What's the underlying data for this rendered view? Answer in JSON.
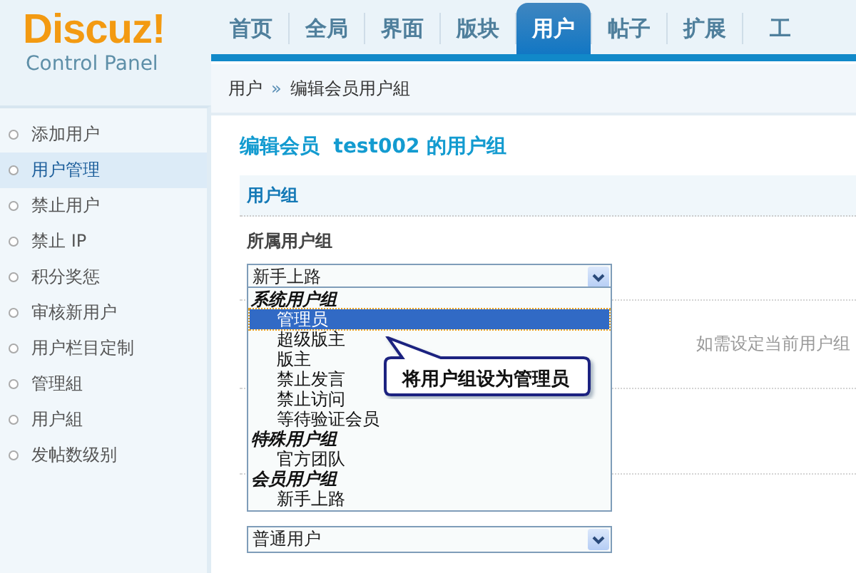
{
  "logo": {
    "name": "Discuz!",
    "subtitle": "Control Panel"
  },
  "nav_tabs": [
    {
      "label": "首页",
      "selected": false
    },
    {
      "label": "全局",
      "selected": false
    },
    {
      "label": "界面",
      "selected": false
    },
    {
      "label": "版块",
      "selected": false
    },
    {
      "label": "用户",
      "selected": true
    },
    {
      "label": "帖子",
      "selected": false
    },
    {
      "label": "扩展",
      "selected": false
    },
    {
      "label": "工",
      "selected": false
    }
  ],
  "breadcrumb": {
    "items": [
      "用户",
      "编辑会员用户組"
    ],
    "separator": "»"
  },
  "sidebar": {
    "items": [
      {
        "label": "添加用户",
        "selected": false
      },
      {
        "label": "用户管理",
        "selected": true
      },
      {
        "label": "禁止用户",
        "selected": false
      },
      {
        "label": "禁止  IP",
        "selected": false
      },
      {
        "label": "积分奖惩",
        "selected": false
      },
      {
        "label": "审核新用户",
        "selected": false
      },
      {
        "label": "用户栏目定制",
        "selected": false
      },
      {
        "label": "管理組",
        "selected": false
      },
      {
        "label": "用户組",
        "selected": false
      },
      {
        "label": "发帖数级别",
        "selected": false
      }
    ]
  },
  "page_title": "编辑会员  test002 的用户组",
  "section_header": "用户组",
  "field_label": "所属用户组",
  "group_select": {
    "value": "新手上路",
    "open": true,
    "groups": [
      {
        "heading": "系统用户组",
        "options": [
          {
            "label": "管理员",
            "selected": true
          },
          {
            "label": "超级版主",
            "selected": false
          },
          {
            "label": "版主",
            "selected": false
          },
          {
            "label": "禁止发言",
            "selected": false
          },
          {
            "label": "禁止访问",
            "selected": false
          },
          {
            "label": "等待验证会员",
            "selected": false
          }
        ]
      },
      {
        "heading": "特殊用户组",
        "options": [
          {
            "label": "官方团队",
            "selected": false
          }
        ]
      },
      {
        "heading": "会员用户组",
        "options": [
          {
            "label": "新手上路",
            "selected": false
          }
        ]
      }
    ]
  },
  "callout": "将用户组设为管理员",
  "hint": "如需设定当前用户组",
  "second_select": {
    "value": "普通用户"
  }
}
